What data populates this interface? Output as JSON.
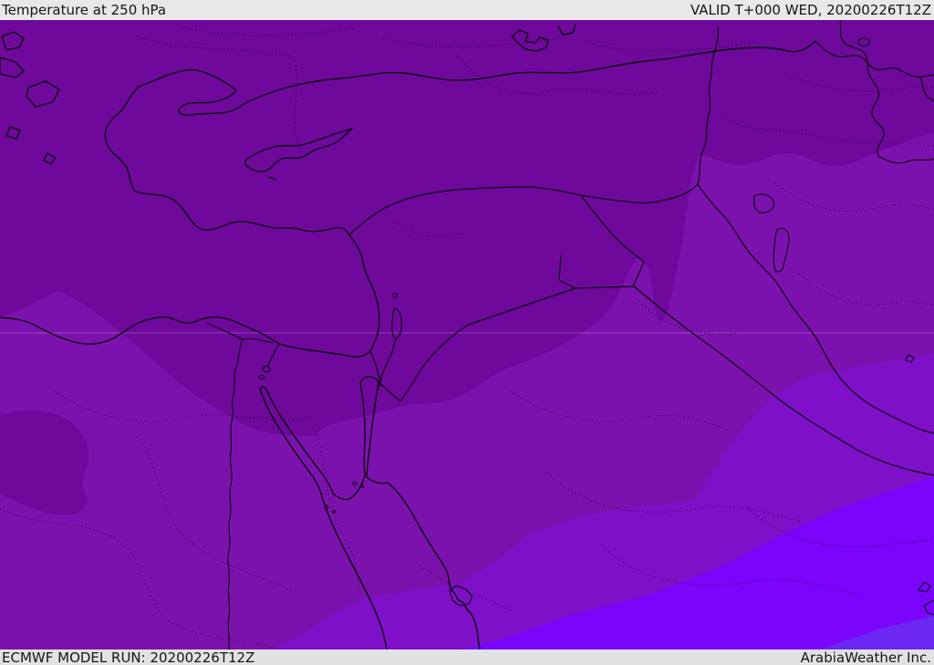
{
  "header": {
    "title": "Temperature at 250 hPa",
    "valid_label": "VALID T+000 WED, 20200226T12Z"
  },
  "footer": {
    "model_run": "ECMWF MODEL RUN: 20200226T12Z",
    "credit": "ArabiaWeather Inc."
  },
  "map": {
    "parameter": "Temperature",
    "level": "250 hPa",
    "region": "Middle East / Eastern Mediterranean",
    "band_colors": {
      "band_1_north_darkest": "#6e099c",
      "band_2": "#7c12ae",
      "band_3": "#7e10c8",
      "band_4": "#7a05fa",
      "band_5_corner": "#6c28f2"
    },
    "line_color": "#0b050e",
    "gridline_color": "rgba(255,255,255,0.18)",
    "topbar_bg": "#e8e8e8",
    "bottombar_bg": "#e2e2e2"
  }
}
